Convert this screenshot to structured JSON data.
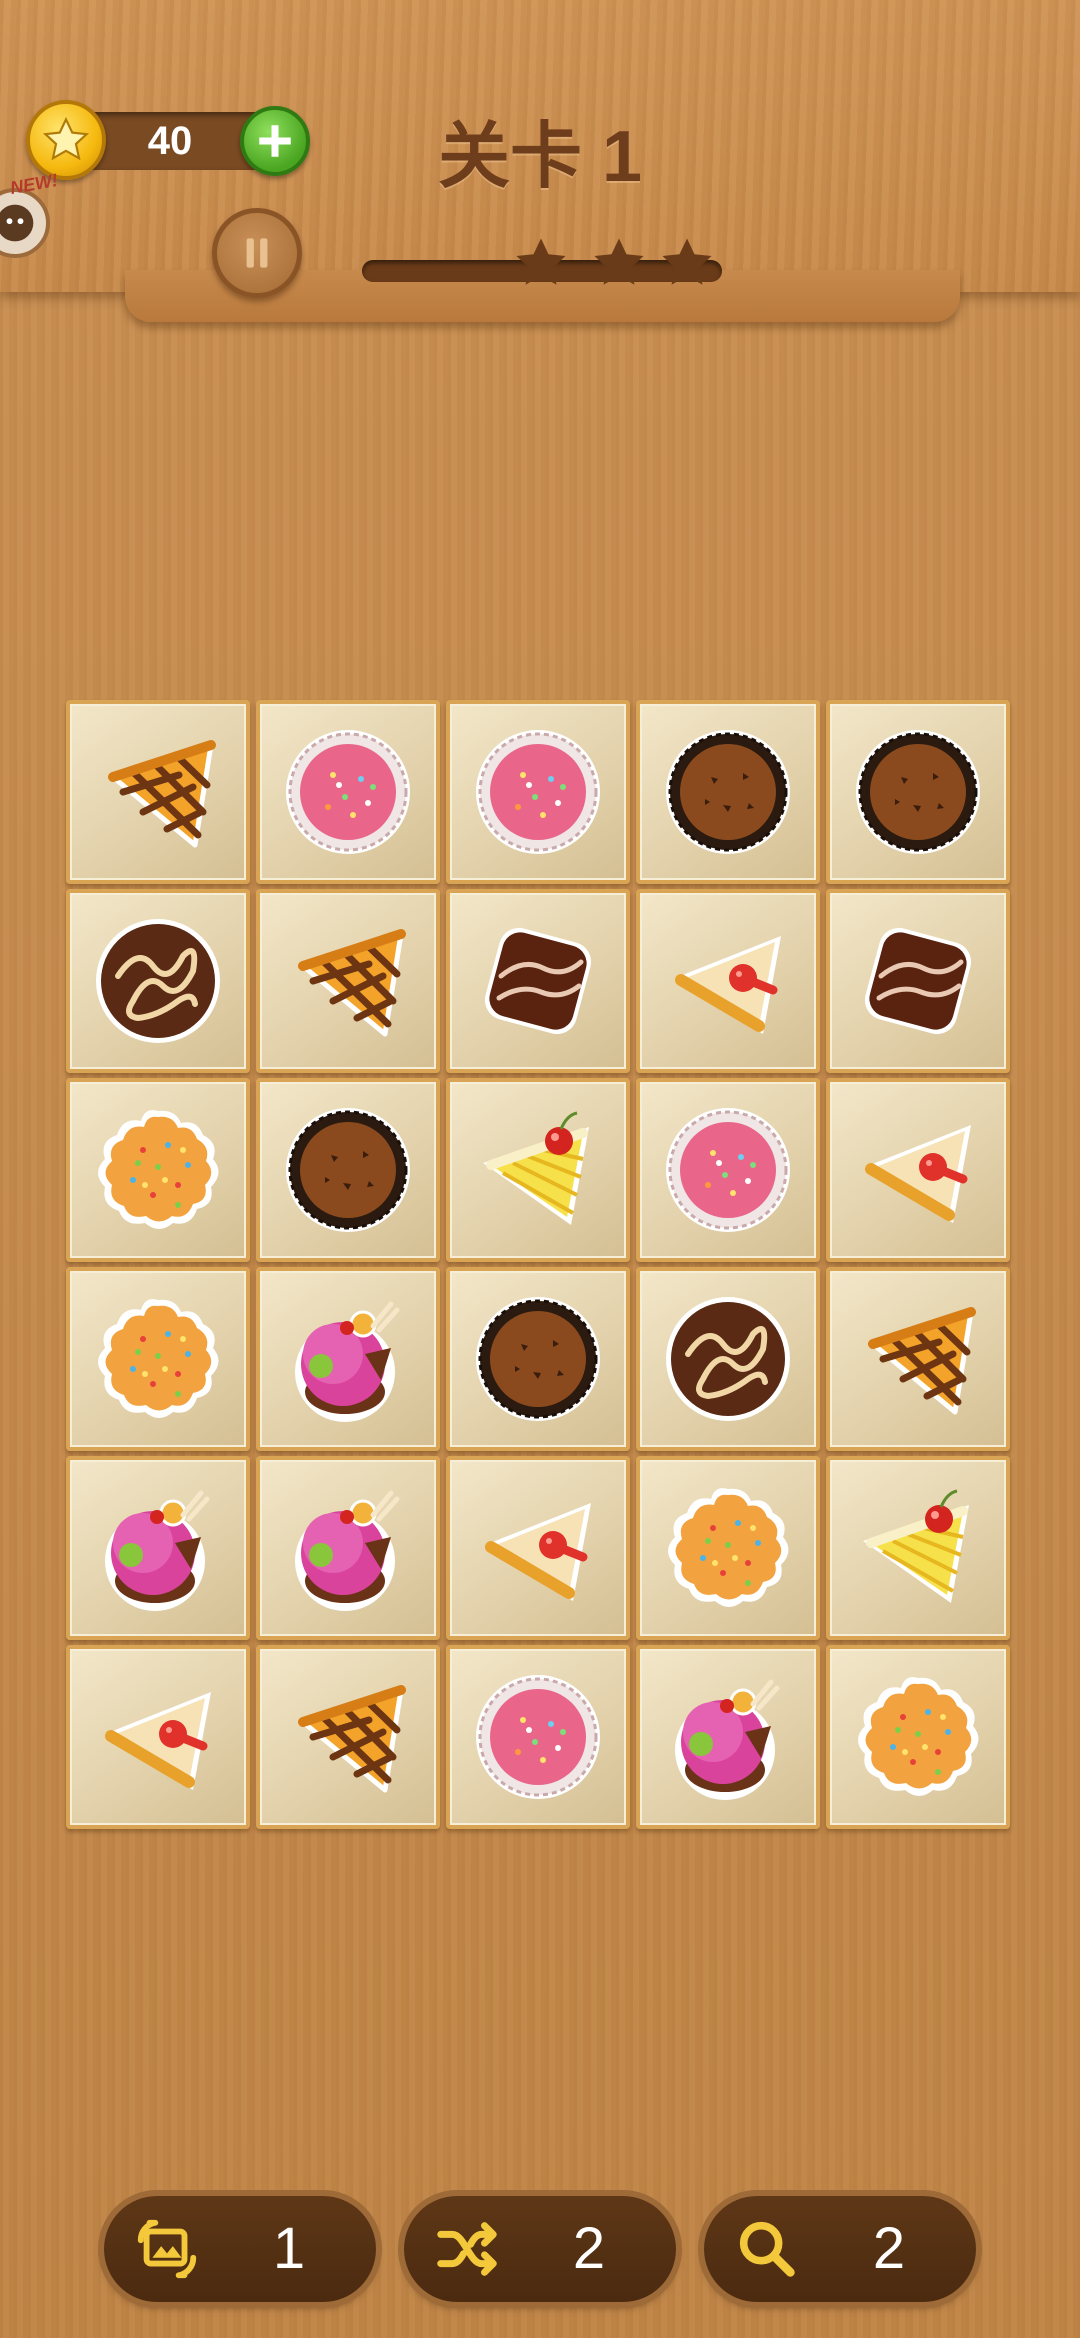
{
  "header": {
    "coins": "40",
    "level_title": "关卡 1",
    "new_badge": "NEW!",
    "stars_earned": 0,
    "stars_total": 3
  },
  "board": {
    "rows": 6,
    "cols": 5,
    "tiles": [
      [
        "pie-slice-lattice",
        "pink-cupcake",
        "pink-cupcake",
        "chocolate-chip-cookie",
        "chocolate-chip-cookie"
      ],
      [
        "swirl-cookie",
        "pie-slice-lattice",
        "chocolate-bar",
        "cheesecake-strawberry",
        "chocolate-bar"
      ],
      [
        "sprinkle-cookie",
        "chocolate-chip-cookie",
        "pineapple-cherry-cake",
        "pink-cupcake",
        "cheesecake-strawberry"
      ],
      [
        "sprinkle-cookie",
        "ice-cream-sundae",
        "chocolate-chip-cookie",
        "swirl-cookie",
        "pie-slice-lattice"
      ],
      [
        "ice-cream-sundae",
        "ice-cream-sundae",
        "cheesecake-strawberry",
        "sprinkle-cookie",
        "pineapple-cherry-cake"
      ],
      [
        "cheesecake-strawberry",
        "pie-slice-lattice",
        "pink-cupcake",
        "ice-cream-sundae",
        "sprinkle-cookie"
      ]
    ]
  },
  "tools": [
    {
      "name": "swap-tool",
      "icon": "swap-images-icon",
      "count": "1"
    },
    {
      "name": "shuffle-tool",
      "icon": "shuffle-icon",
      "count": "2"
    },
    {
      "name": "hint-tool",
      "icon": "magnifier-icon",
      "count": "2"
    }
  ],
  "colors": {
    "wood": "#c98f52",
    "tile_border": "#d9a555",
    "dark_wood": "#4b2a10",
    "accent_gold": "#f5b90f"
  }
}
